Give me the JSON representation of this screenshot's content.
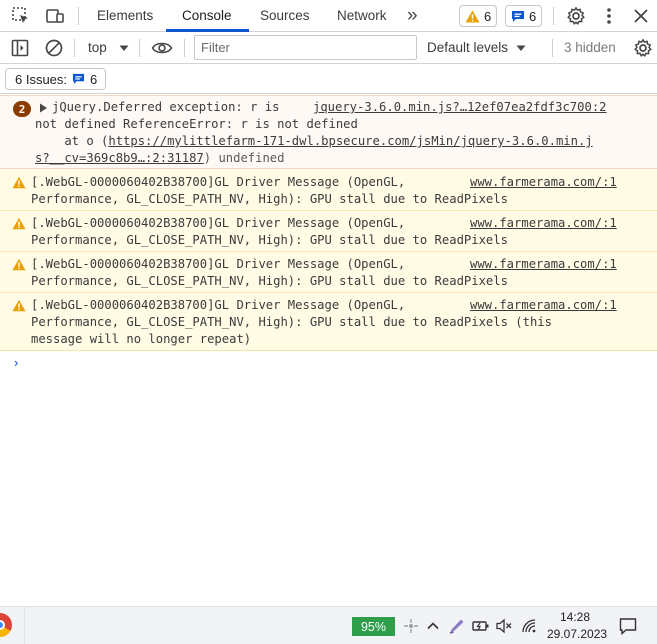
{
  "tabbar": {
    "tabs": [
      "Elements",
      "Console",
      "Sources",
      "Network"
    ],
    "active": "Console",
    "warnings_count": "6",
    "messages_count": "6",
    "more_label": "»"
  },
  "toolbar": {
    "context": "top",
    "filter_placeholder": "Filter",
    "levels_label": "Default levels",
    "hidden_label": "3 hidden"
  },
  "issues": {
    "label": "6 Issues:",
    "count": "6"
  },
  "console": {
    "error": {
      "repeat": "2",
      "line1": "jQuery.Deferred exception: r is",
      "source": "jquery-3.6.0.min.js?…12ef07ea2fdf3c700:2",
      "line2": "not defined ReferenceError: r is not defined",
      "line3_prefix": "    at o (",
      "line3_link": "https://mylittlefarm-171-dwl.bpsecure.com/jsMin/jquery-3.6.0.min.j",
      "line4_link": "s?__cv=369c8b9…:2:31187",
      "line4_suffix": ") undefined"
    },
    "warnings": [
      {
        "line1": "[.WebGL-0000060402B38700]GL Driver Message (OpenGL,",
        "source": "www.farmerama.com/:1",
        "line2": "Performance, GL_CLOSE_PATH_NV, High): GPU stall due to ReadPixels",
        "line3": ""
      },
      {
        "line1": "[.WebGL-0000060402B38700]GL Driver Message (OpenGL,",
        "source": "www.farmerama.com/:1",
        "line2": "Performance, GL_CLOSE_PATH_NV, High): GPU stall due to ReadPixels",
        "line3": ""
      },
      {
        "line1": "[.WebGL-0000060402B38700]GL Driver Message (OpenGL,",
        "source": "www.farmerama.com/:1",
        "line2": "Performance, GL_CLOSE_PATH_NV, High): GPU stall due to ReadPixels",
        "line3": ""
      },
      {
        "line1": "[.WebGL-0000060402B38700]GL Driver Message (OpenGL,",
        "source": "www.farmerama.com/:1",
        "line2": "Performance, GL_CLOSE_PATH_NV, High): GPU stall due to ReadPixels (this",
        "line3": "message will no longer repeat)"
      }
    ],
    "prompt": "›"
  },
  "taskbar": {
    "battery": "95%",
    "time": "14:28",
    "date": "29.07.2023"
  },
  "colors": {
    "accent": "#0b57d0",
    "warning": "#e8a100",
    "error_badge": "#8a3c00",
    "battery": "#2e9e4b"
  }
}
